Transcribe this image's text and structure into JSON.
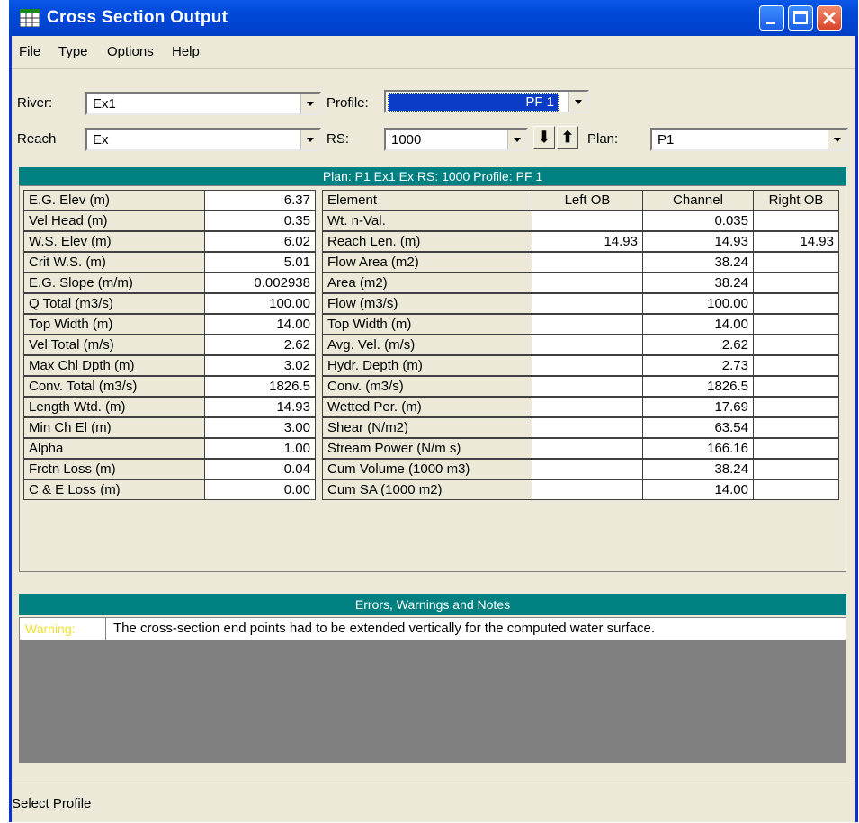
{
  "window": {
    "title": "Cross Section Output"
  },
  "menu": [
    "File",
    "Type",
    "Options",
    "Help"
  ],
  "selectors": {
    "river_label": "River:",
    "river_value": "Ex1",
    "reach_label": "Reach",
    "reach_value": "Ex",
    "profile_label": "Profile:",
    "profile_value": "PF 1",
    "rs_label": "RS:",
    "rs_value": "1000",
    "down_arrow": "⬇",
    "up_arrow": "⬆",
    "plan_label": "Plan:",
    "plan_value": "P1"
  },
  "banner": {
    "text": "Plan: P1    Ex1    Ex  RS: 1000    Profile: PF 1"
  },
  "left_table": [
    {
      "label": "E.G. Elev (m)",
      "value": "6.37"
    },
    {
      "label": "Vel Head (m)",
      "value": "0.35"
    },
    {
      "label": "W.S. Elev (m)",
      "value": "6.02"
    },
    {
      "label": "Crit W.S. (m)",
      "value": "5.01"
    },
    {
      "label": "E.G. Slope (m/m)",
      "value": "0.002938"
    },
    {
      "label": "Q Total (m3/s)",
      "value": "100.00"
    },
    {
      "label": "Top Width (m)",
      "value": "14.00"
    },
    {
      "label": "Vel Total (m/s)",
      "value": "2.62"
    },
    {
      "label": "Max Chl Dpth (m)",
      "value": "3.02"
    },
    {
      "label": "Conv. Total (m3/s)",
      "value": "1826.5"
    },
    {
      "label": "Length Wtd. (m)",
      "value": "14.93"
    },
    {
      "label": "Min Ch El (m)",
      "value": "3.00"
    },
    {
      "label": "Alpha",
      "value": "1.00"
    },
    {
      "label": "Frctn Loss (m)",
      "value": "0.04"
    },
    {
      "label": "C & E Loss (m)",
      "value": "0.00"
    }
  ],
  "right_table": {
    "headers": [
      "Element",
      "Left OB",
      "Channel",
      "Right OB"
    ],
    "rows": [
      {
        "element": "Wt. n-Val.",
        "left": "",
        "channel": "0.035",
        "right": ""
      },
      {
        "element": "Reach Len. (m)",
        "left": "14.93",
        "channel": "14.93",
        "right": "14.93"
      },
      {
        "element": "Flow Area (m2)",
        "left": "",
        "channel": "38.24",
        "right": ""
      },
      {
        "element": "Area (m2)",
        "left": "",
        "channel": "38.24",
        "right": ""
      },
      {
        "element": "Flow (m3/s)",
        "left": "",
        "channel": "100.00",
        "right": ""
      },
      {
        "element": "Top Width (m)",
        "left": "",
        "channel": "14.00",
        "right": ""
      },
      {
        "element": "Avg. Vel. (m/s)",
        "left": "",
        "channel": "2.62",
        "right": ""
      },
      {
        "element": "Hydr. Depth (m)",
        "left": "",
        "channel": "2.73",
        "right": ""
      },
      {
        "element": "Conv. (m3/s)",
        "left": "",
        "channel": "1826.5",
        "right": ""
      },
      {
        "element": "Wetted Per. (m)",
        "left": "",
        "channel": "17.69",
        "right": ""
      },
      {
        "element": "Shear (N/m2)",
        "left": "",
        "channel": "63.54",
        "right": ""
      },
      {
        "element": "Stream Power (N/m s)",
        "left": "",
        "channel": "166.16",
        "right": ""
      },
      {
        "element": "Cum Volume (1000 m3)",
        "left": "",
        "channel": "38.24",
        "right": ""
      },
      {
        "element": "Cum SA (1000 m2)",
        "left": "",
        "channel": "14.00",
        "right": ""
      }
    ]
  },
  "notes": {
    "banner": "Errors, Warnings and Notes",
    "tag": "Warning:",
    "message": "The cross-section end points had to be extended vertically for the computed water surface."
  },
  "status": {
    "text": "Select Profile"
  },
  "colors": {
    "titlebar": "#0048d8",
    "banner": "#008080",
    "profile_highlight": "#0a3cc8",
    "warning_tag": "#f0e030"
  }
}
